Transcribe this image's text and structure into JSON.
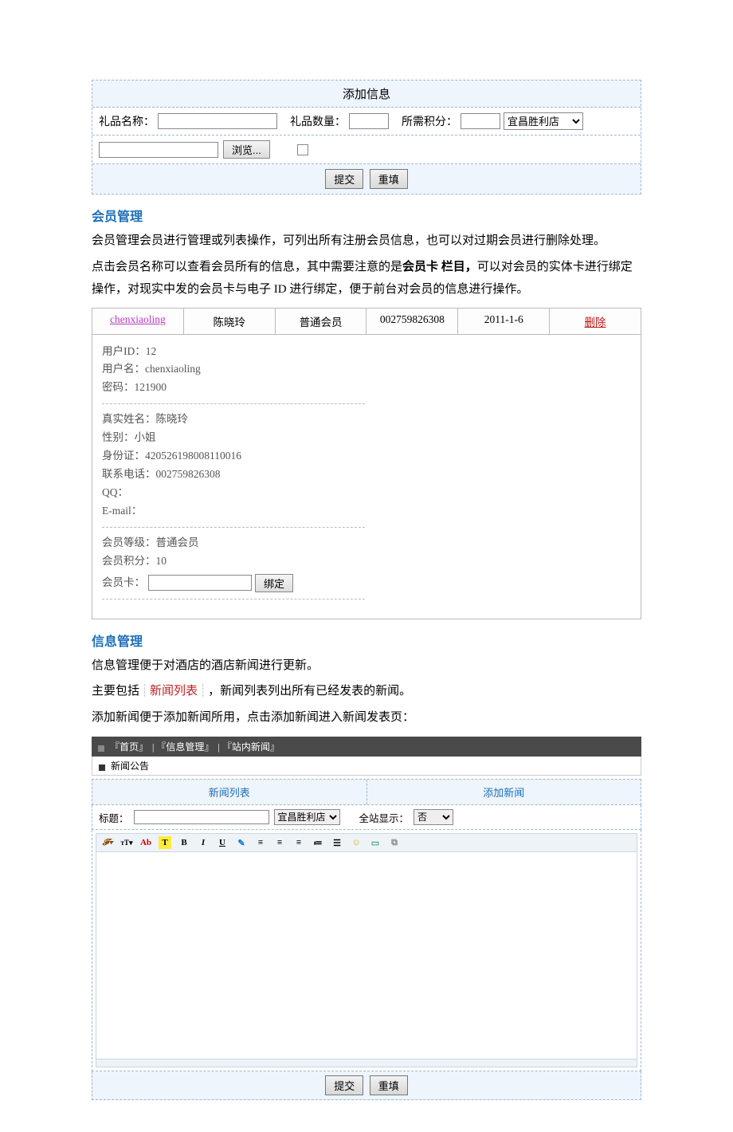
{
  "panel1": {
    "header": "添加信息",
    "gift_name_label": "礼品名称：",
    "gift_qty_label": "礼品数量：",
    "points_label": "所需积分：",
    "store_option": "宜昌胜利店",
    "browse_label": "浏览...",
    "submit_label": "提交",
    "reset_label": "重填"
  },
  "sec_member": {
    "title": "会员管理",
    "p1": "会员管理会员进行管理或列表操作，可列出所有注册会员信息，也可以对过期会员进行删除处理。",
    "p2a": "点击会员名称可以查看会员所有的信息，其中需要注意的是",
    "p2b": "会员卡 栏目，",
    "p2c": "可以对会员的实体卡进行绑定操作，对现实中发的会员卡与电子 ID 进行绑定，便于前台对会员的信息进行操作。"
  },
  "member_head": {
    "username": "chenxiaoling",
    "realname": "陈晓玲",
    "level": "普通会员",
    "phone": "002759826308",
    "date": "2011-1-6",
    "delete": "删除"
  },
  "member_detail": {
    "l1": "用户ID：12",
    "l2": "用户名：chenxiaoling",
    "l3": "密码：121900",
    "l4": "真实姓名：陈晓玲",
    "l5": "性别：小姐",
    "l6": "身份证：420526198008110016",
    "l7": "联系电话：002759826308",
    "l8": "QQ：",
    "l9": "E-mail：",
    "l10": "会员等级：普通会员",
    "l11": "会员积分：10",
    "card_label": "会员卡：",
    "bind_btn": "绑定"
  },
  "sec_info": {
    "title": "信息管理",
    "p1": "信息管理便于对酒店的酒店新闻进行更新。",
    "p2a": "主要包括",
    "p2b": "新闻列表",
    "p2c": "，新闻列表列出所有已经发表的新闻。",
    "p3": "添加新闻便于添加新闻所用，点击添加新闻进入新闻发表页："
  },
  "news": {
    "bread1": "『首页』",
    "bread2": "『信息管理』",
    "bread3": "『站内新闻』",
    "subbar": "新闻公告",
    "tab1": "新闻列表",
    "tab2": "添加新闻",
    "title_label": "标题：",
    "store_option": "宜昌胜利店",
    "global_label": "全站显示：",
    "global_option": "否",
    "submit": "提交",
    "reset": "重填"
  },
  "toolbar": {
    "font": "F",
    "size": "T",
    "size2": "T",
    "color": "Ab",
    "hl": "T",
    "bold": "B",
    "italic": "I",
    "underline": "U"
  }
}
